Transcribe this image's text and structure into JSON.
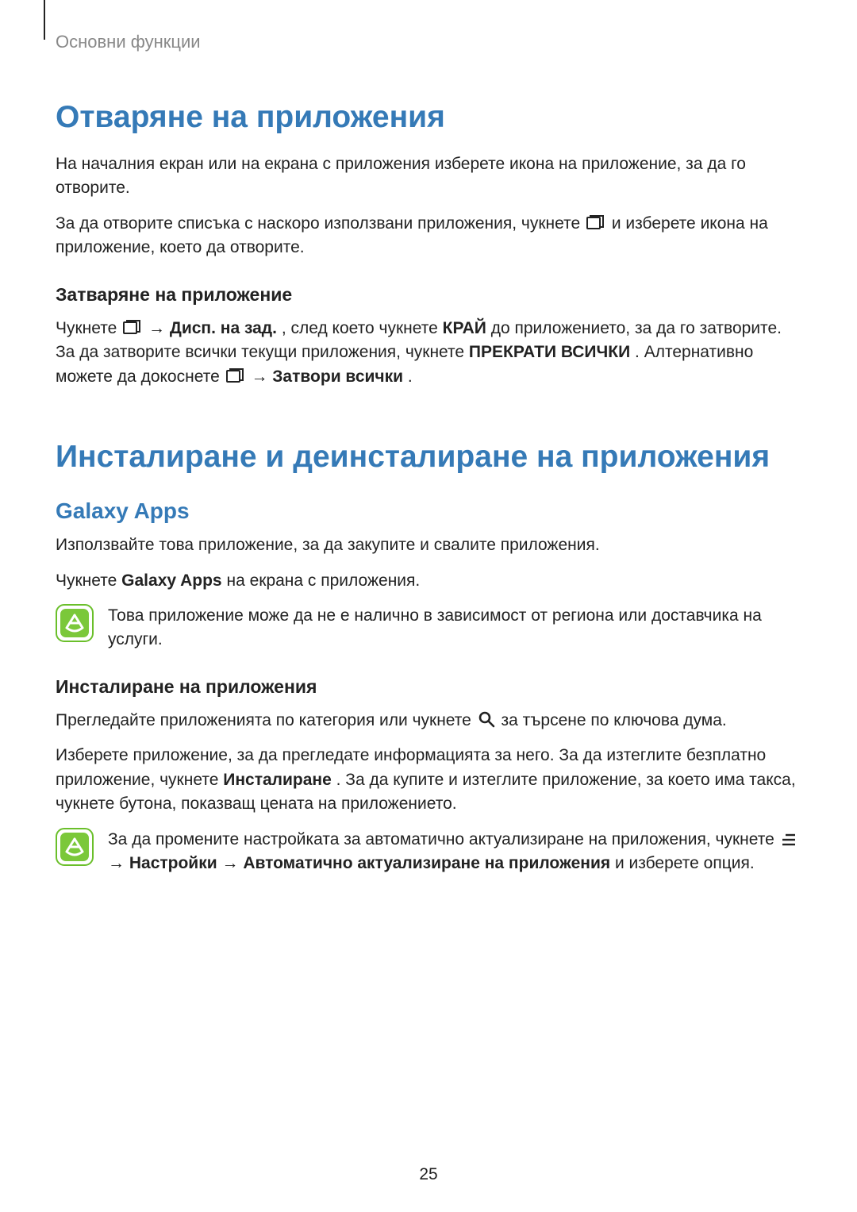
{
  "header": {
    "section": "Основни функции"
  },
  "h1_open": "Отваряне на приложения",
  "p_open_1": "На началния екран или на екрана с приложения изберете икона на приложение, за да го отворите.",
  "p_open_2a": "За да отворите списъка с наскоро използвани приложения, чукнете ",
  "p_open_2b": " и изберете икона на приложение, което да отворите.",
  "h3_close": "Затваряне на приложение",
  "close_para": {
    "a": "Чукнете ",
    "b": " → ",
    "disp": "Дисп. на зад.",
    "c": ", след което чукнете ",
    "end": "КРАЙ",
    "d": " до приложението, за да го затворите. За да затворите всички текущи приложения, чукнете ",
    "stopall": "ПРЕКРАТИ ВСИЧКИ",
    "e": ". Алтернативно можете да докоснете ",
    "f": " → ",
    "closeall": "Затвори всички",
    "g": "."
  },
  "h1_install": "Инсталиране и деинсталиране на приложения",
  "h2_galaxy": "Galaxy Apps",
  "p_galaxy_1": "Използвайте това приложение, за да закупите и свалите приложения.",
  "p_galaxy_2a": "Чукнете ",
  "p_galaxy_2_bold": "Galaxy Apps",
  "p_galaxy_2b": " на екрана с приложения.",
  "note1": "Това приложение може да не е налично в зависимост от региона или доставчика на услуги.",
  "h3_install": "Инсталиране на приложения",
  "p_install_1a": "Прегледайте приложенията по категория или чукнете ",
  "p_install_1b": " за търсене по ключова дума.",
  "p_install_2a": "Изберете приложение, за да прегледате информацията за него. За да изтеглите безплатно приложение, чукнете ",
  "p_install_2_bold": "Инсталиране",
  "p_install_2b": ". За да купите и изтеглите приложение, за което има такса, чукнете бутона, показващ цената на приложението.",
  "note2": {
    "a": "За да промените настройката за автоматично актуализиране на приложения, чукнете ",
    "b": " → ",
    "bold1": "Настройки",
    "c": " → ",
    "bold2": "Автоматично актуализиране на приложения",
    "d": " и изберете опция."
  },
  "page_number": "25"
}
